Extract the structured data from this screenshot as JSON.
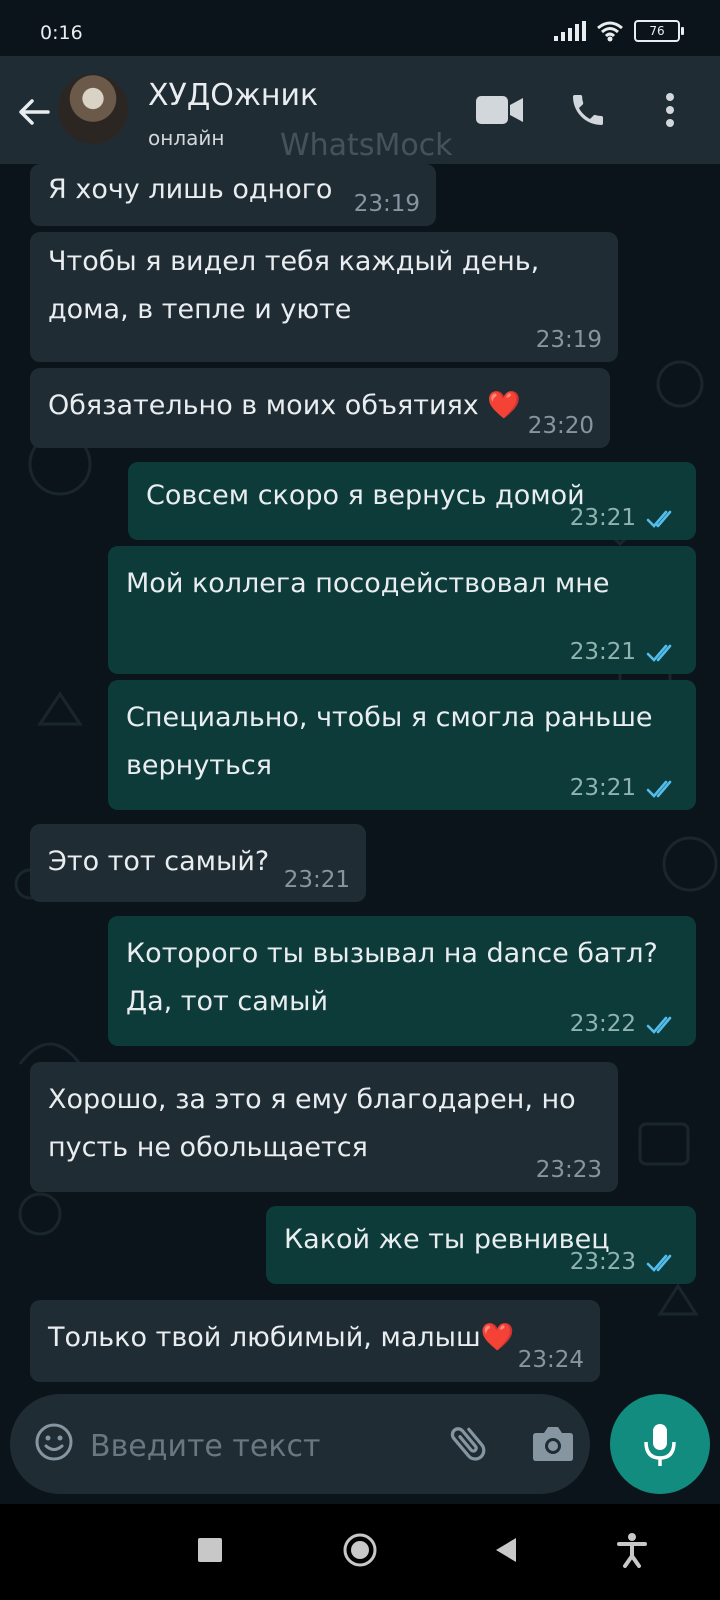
{
  "status_bar": {
    "time": "0:16",
    "battery": "76"
  },
  "header": {
    "contact_name": "ХУДОжник",
    "contact_status": "онлайн",
    "watermark": "WhatsMock",
    "icons": [
      "back-arrow-icon",
      "avatar",
      "video-call-icon",
      "phone-icon",
      "more-vert-icon"
    ]
  },
  "messages": [
    {
      "dir": "in",
      "text": "Я хочу лишь одного",
      "time": "23:19"
    },
    {
      "dir": "in",
      "text": "Чтобы я видел тебя каждый день, дома, в тепле и уюте",
      "time": "23:19"
    },
    {
      "dir": "in",
      "text": "Обязательно в моих объятиях ❤️",
      "time": "23:20"
    },
    {
      "dir": "out",
      "text": "Совсем скоро я вернусь домой",
      "time": "23:21",
      "status": "read"
    },
    {
      "dir": "out",
      "text": "Мой коллега посодействовал мне",
      "time": "23:21",
      "status": "read"
    },
    {
      "dir": "out",
      "text": "Специально, чтобы я смогла раньше вернуться",
      "time": "23:21",
      "status": "read"
    },
    {
      "dir": "in",
      "text": "Это тот самый?",
      "time": "23:21"
    },
    {
      "dir": "out",
      "text": "Которого ты вызывал на dance батл? Да, тот самый",
      "time": "23:22",
      "status": "read"
    },
    {
      "dir": "in",
      "text": "Хорошо, за это я ему благодарен, но пусть не обольщается",
      "time": "23:23"
    },
    {
      "dir": "out",
      "text": "Какой же ты ревнивец",
      "time": "23:23",
      "status": "read"
    },
    {
      "dir": "in",
      "text": "Только твой любимый, малыш❤️",
      "time": "23:24"
    }
  ],
  "composer": {
    "placeholder": "Введите текст"
  },
  "colors": {
    "incoming": "#1f2c34",
    "outgoing": "#0d3b3a",
    "read_tick": "#53bdeb",
    "accent": "#128c7e"
  }
}
